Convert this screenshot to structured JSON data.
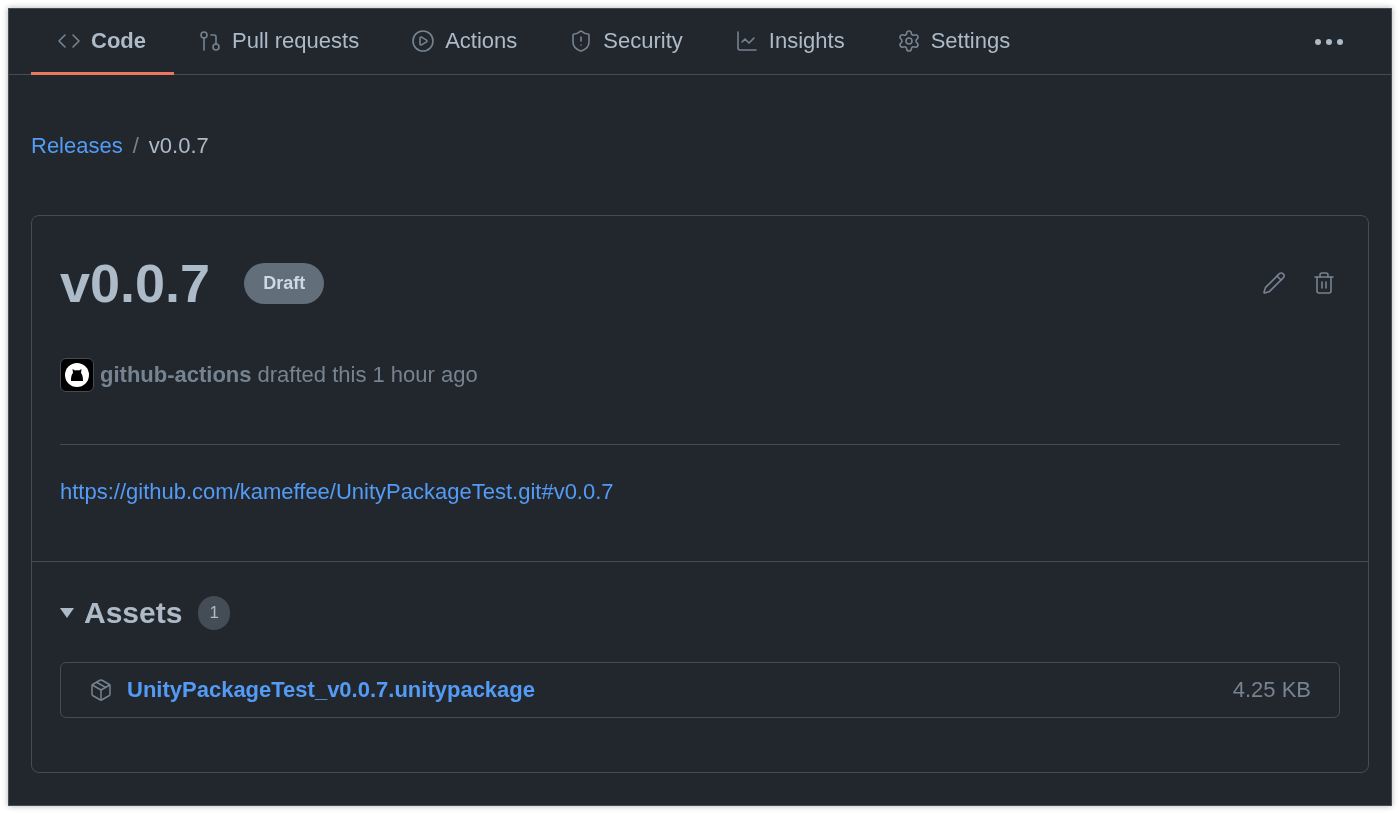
{
  "tabs": [
    {
      "label": "Code",
      "selected": true
    },
    {
      "label": "Pull requests",
      "selected": false
    },
    {
      "label": "Actions",
      "selected": false
    },
    {
      "label": "Security",
      "selected": false
    },
    {
      "label": "Insights",
      "selected": false
    },
    {
      "label": "Settings",
      "selected": false
    }
  ],
  "breadcrumb": {
    "link": "Releases",
    "separator": "/",
    "current": "v0.0.7"
  },
  "release": {
    "title": "v0.0.7",
    "badge": "Draft",
    "author": "github-actions",
    "meta": "drafted this 1 hour ago",
    "body_link": "https://github.com/kameffee/UnityPackageTest.git#v0.0.7"
  },
  "assets": {
    "title": "Assets",
    "count": "1",
    "expanded": true,
    "items": [
      {
        "name": "UnityPackageTest_v0.0.7.unitypackage",
        "size": "4.25 KB"
      }
    ]
  }
}
